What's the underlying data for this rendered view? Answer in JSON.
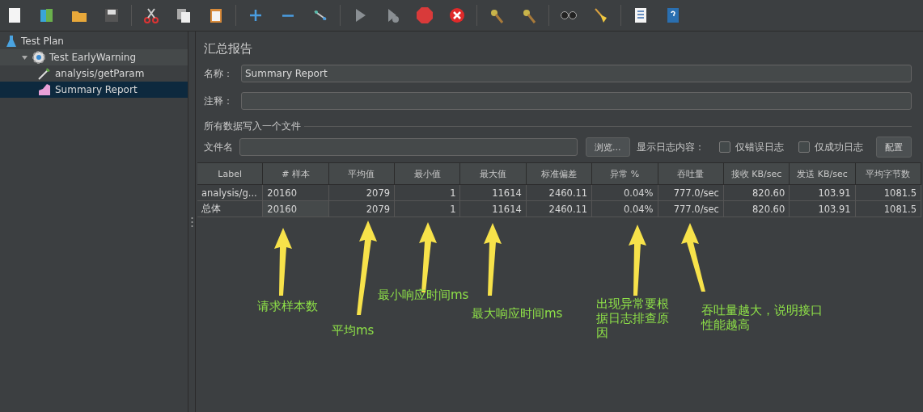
{
  "tree": [
    {
      "label": "Test Plan",
      "kind": "plan",
      "selected": false,
      "children": [
        {
          "label": "Test EarlyWarning",
          "kind": "group",
          "selected": false,
          "expanded": true,
          "children": [
            {
              "label": "analysis/getParam",
              "kind": "sampler",
              "selected": false
            },
            {
              "label": "Summary Report",
              "kind": "report",
              "selected": true
            }
          ]
        }
      ]
    }
  ],
  "panel": {
    "title": "汇总报告",
    "name_label": "名称：",
    "name_value": "Summary Report",
    "comment_label": "注释：",
    "file_section": "所有数据写入一个文件",
    "file_label": "文件名",
    "browse": "浏览...",
    "log_label": "显示日志内容：",
    "checks": [
      {
        "label": "仅错误日志",
        "checked": false
      },
      {
        "label": "仅成功日志",
        "checked": false
      }
    ],
    "config": "配置"
  },
  "table": {
    "columns": [
      "Label",
      "# 样本",
      "平均值",
      "最小值",
      "最大值",
      "标准偏差",
      "异常 %",
      "吞吐量",
      "接收 KB/sec",
      "发送 KB/sec",
      "平均字节数"
    ],
    "rows": [
      [
        "analysis/g...",
        "20160",
        "2079",
        "1",
        "11614",
        "2460.11",
        "0.04%",
        "777.0/sec",
        "820.60",
        "103.91",
        "1081.5"
      ],
      [
        "总体",
        "20160",
        "2079",
        "1",
        "11614",
        "2460.11",
        "0.04%",
        "777.0/sec",
        "820.60",
        "103.91",
        "1081.5"
      ]
    ]
  },
  "annotations": [
    "请求样本数",
    "平均ms",
    "最小响应时间ms",
    "最大响应时间ms",
    "出现异常要根据日志排查原因",
    "吞吐量越大，说明接口性能越高"
  ]
}
